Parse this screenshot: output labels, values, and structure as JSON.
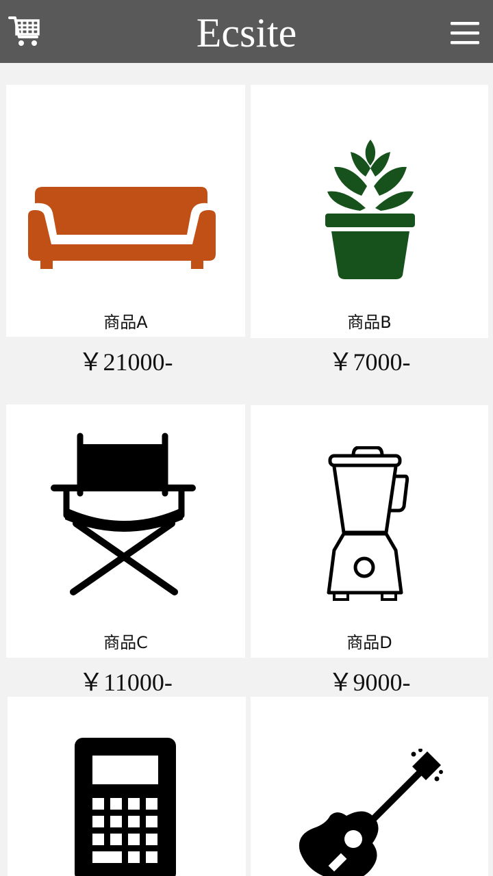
{
  "header": {
    "title": "Ecsite",
    "cart_icon": "cart-icon",
    "menu_icon": "hamburger-menu-icon",
    "background_color": "#595959"
  },
  "products": [
    {
      "name": "商品A",
      "price": "￥21000-",
      "icon": "sofa-icon",
      "color": "#c05015"
    },
    {
      "name": "商品B",
      "price": "￥7000-",
      "icon": "potted-plant-icon",
      "color": "#17521c"
    },
    {
      "name": "商品C",
      "price": "￥11000-",
      "icon": "directors-chair-icon",
      "color": "#000000"
    },
    {
      "name": "商品D",
      "price": "￥9000-",
      "icon": "blender-icon",
      "color": "#000000"
    },
    {
      "name": "",
      "price": "",
      "icon": "calculator-icon",
      "color": "#000000"
    },
    {
      "name": "",
      "price": "",
      "icon": "guitar-icon",
      "color": "#000000"
    }
  ]
}
